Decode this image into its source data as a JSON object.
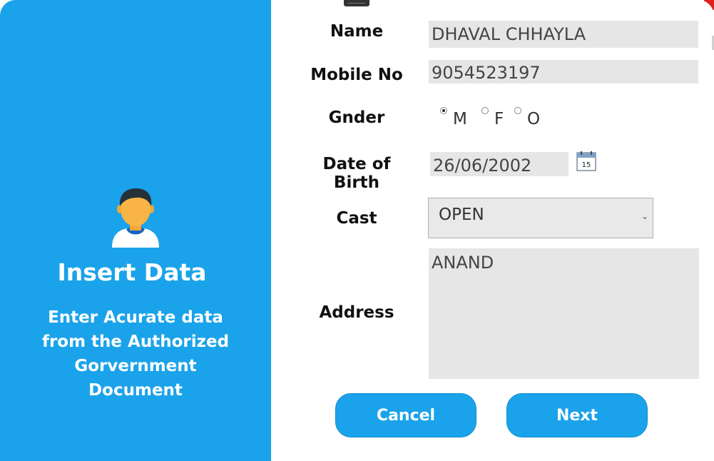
{
  "sidebar": {
    "title": "Insert Data",
    "subtitle": "Enter Acurate data from the Authorized Gorvernment Document",
    "avatar_icon": "user-avatar-icon"
  },
  "form": {
    "name": {
      "label": "Name",
      "value": "DHAVAL CHHAYLA"
    },
    "mobile": {
      "label": "Mobile No",
      "value": "9054523197"
    },
    "gender": {
      "label": "Gnder",
      "options": [
        {
          "label": "M",
          "checked": true
        },
        {
          "label": "F",
          "checked": false
        },
        {
          "label": "O",
          "checked": false
        }
      ]
    },
    "dob": {
      "label": "Date of Birth",
      "value": "26/06/2002",
      "calendar_icon_text": "15"
    },
    "cast": {
      "label": "Cast",
      "value": "OPEN"
    },
    "address": {
      "label": "Address",
      "value": "ANAND"
    }
  },
  "buttons": {
    "cancel": "Cancel",
    "next": "Next"
  },
  "colors": {
    "accent": "#1aa3ea",
    "field_bg": "#e6e6e6",
    "text_dark": "#111111"
  }
}
